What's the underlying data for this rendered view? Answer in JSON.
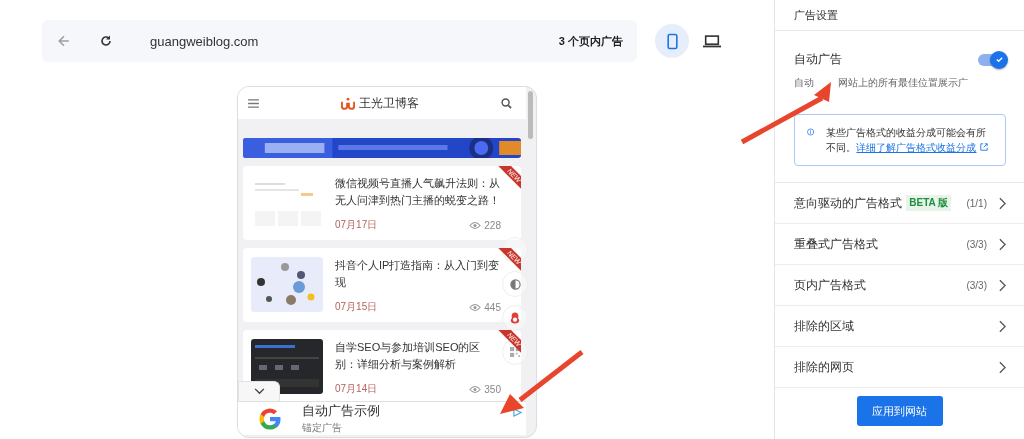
{
  "preview_bar": {
    "url": "guangweiblog.com",
    "ad_count": "3 个页内广告"
  },
  "devices": [
    {
      "kind": "phone",
      "selected": true
    },
    {
      "kind": "laptop",
      "selected": false
    }
  ],
  "phone": {
    "site_title": "王光卫博客",
    "articles": [
      {
        "title": "微信视频号直播人气飙升法则：从无人问津到热门主播的蜕变之路！",
        "date": "07月17日",
        "views": "228",
        "badge": "NEW"
      },
      {
        "title": "抖音个人IP打造指南：从入门到变现",
        "date": "07月15日",
        "views": "445",
        "badge": "NEW"
      },
      {
        "title": "自学SEO与参加培训SEO的区别：详细分析与案例解析",
        "date": "07月14日",
        "views": "350",
        "badge": "NEW"
      }
    ],
    "anchor_ad": {
      "title": "自动广告示例",
      "subtitle": "锚定广告"
    }
  },
  "settings": {
    "heading": "广告设置",
    "auto_ads": {
      "label": "自动广告",
      "on": true,
      "description_before": "自动",
      "description_after": "网站上的所有最佳位置展示广"
    },
    "info": {
      "text": "某些广告格式的收益分成可能会有所不同。",
      "link": "详细了解广告格式收益分成"
    },
    "rows": [
      {
        "label": "意向驱动的广告格式",
        "badge": "BETA 版",
        "count": "(1/1)"
      },
      {
        "label": "重叠式广告格式",
        "count": "(3/3)"
      },
      {
        "label": "页内广告格式",
        "count": "(3/3)"
      },
      {
        "label": "排除的区域"
      },
      {
        "label": "排除的网页"
      }
    ],
    "apply_button": "应用到网站"
  }
}
